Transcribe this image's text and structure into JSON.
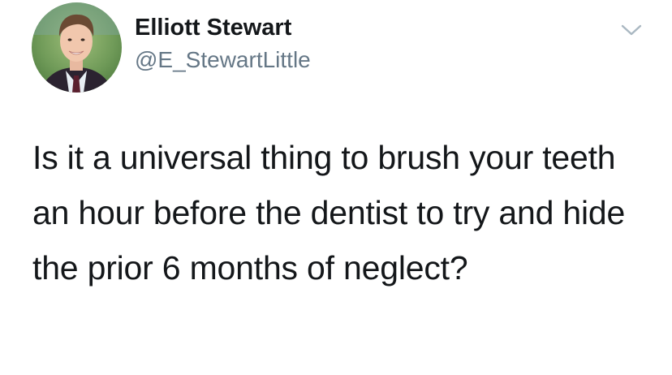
{
  "author": {
    "display_name": "Elliott Stewart",
    "handle": "@E_StewartLittle",
    "avatar_icon": "profile-photo"
  },
  "menu": {
    "icon": "chevron-down-icon"
  },
  "tweet": {
    "text": "Is it a universal thing to brush your teeth an hour before the dentist to try and hide the prior 6 months of neglect?"
  },
  "colors": {
    "text_primary": "#14171a",
    "text_secondary": "#657786",
    "chevron": "#aab8c2",
    "background": "#ffffff"
  }
}
